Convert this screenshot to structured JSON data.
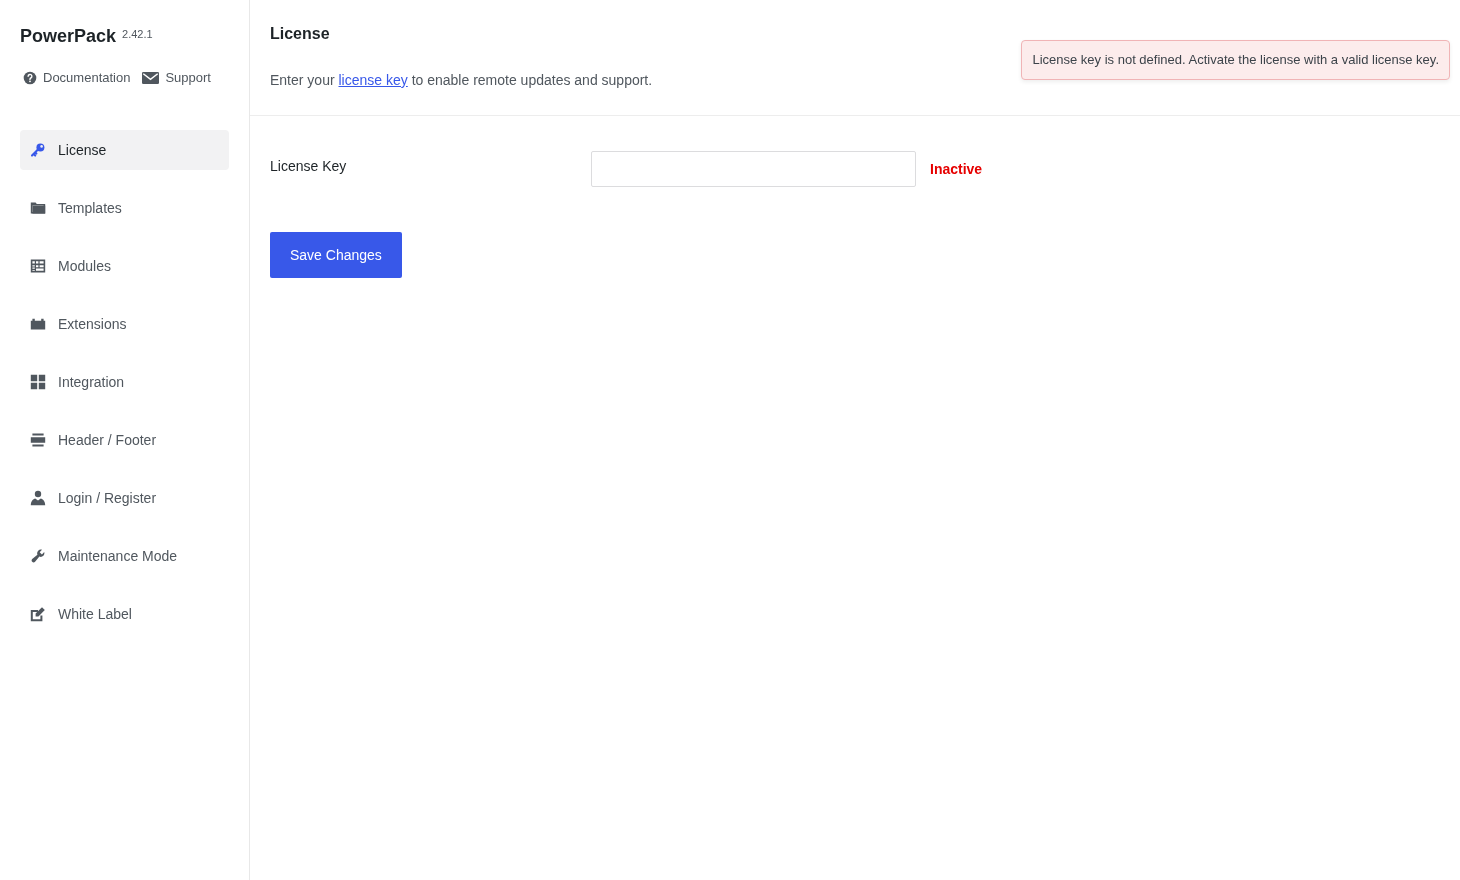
{
  "sidebar": {
    "brand": {
      "name": "PowerPack",
      "version": "2.42.1"
    },
    "links": [
      {
        "label": "Documentation"
      },
      {
        "label": "Support"
      }
    ],
    "items": [
      {
        "label": "License",
        "selected": true
      },
      {
        "label": "Templates",
        "selected": false
      },
      {
        "label": "Modules",
        "selected": false
      },
      {
        "label": "Extensions",
        "selected": false
      },
      {
        "label": "Integration",
        "selected": false
      },
      {
        "label": "Header / Footer",
        "selected": false
      },
      {
        "label": "Login / Register",
        "selected": false
      },
      {
        "label": "Maintenance Mode",
        "selected": false
      },
      {
        "label": "White Label",
        "selected": false
      }
    ]
  },
  "main": {
    "title": "License",
    "description": {
      "before": "Enter your ",
      "link": "license key",
      "after": " to enable remote updates and support."
    },
    "notice": {
      "kind": "error",
      "text": "License key is not defined. Activate the license with a valid license key."
    },
    "fields": [
      {
        "label": "License Key",
        "status": {
          "text": "Inactive",
          "active": false
        }
      }
    ],
    "save_button": {
      "label": "Save Changes"
    }
  }
}
